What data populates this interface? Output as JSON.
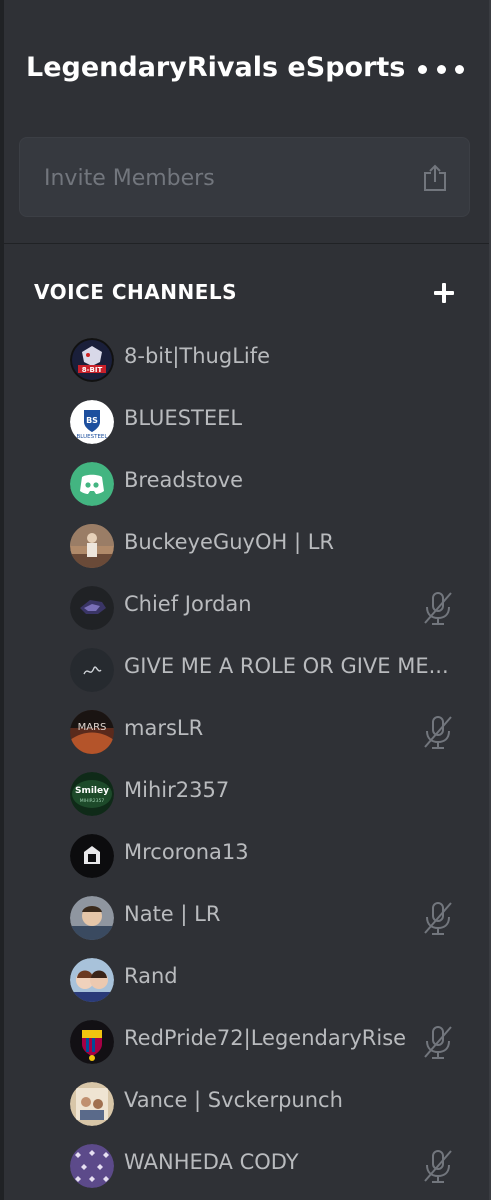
{
  "server": {
    "name": "LegendaryRivals eSports"
  },
  "invite": {
    "label": "Invite Members"
  },
  "section": {
    "title": "VOICE CHANNELS"
  },
  "members": [
    {
      "name": "8-bit|ThugLife",
      "muted": false,
      "avatar_icon": "8bit-logo-icon"
    },
    {
      "name": "BLUESTEEL",
      "muted": false,
      "avatar_icon": "bluesteel-logo-icon"
    },
    {
      "name": "Breadstove",
      "muted": false,
      "avatar_icon": "discord-default-icon"
    },
    {
      "name": "BuckeyeGuyOH | LR",
      "muted": false,
      "avatar_icon": "photo-avatar-icon"
    },
    {
      "name": "Chief Jordan",
      "muted": true,
      "avatar_icon": "panther-logo-icon"
    },
    {
      "name": "GIVE ME A ROLE OR GIVE ME...",
      "muted": false,
      "avatar_icon": "signature-avatar-icon"
    },
    {
      "name": "marsLR",
      "muted": true,
      "avatar_icon": "mars-avatar-icon"
    },
    {
      "name": "Mihir2357",
      "muted": false,
      "avatar_icon": "smiley-logo-icon"
    },
    {
      "name": "Mrcorona13",
      "muted": false,
      "avatar_icon": "dark-logo-icon"
    },
    {
      "name": "Nate | LR",
      "muted": true,
      "avatar_icon": "photo-avatar-icon"
    },
    {
      "name": "Rand",
      "muted": false,
      "avatar_icon": "photo-avatar-icon"
    },
    {
      "name": "RedPride72|LegendaryRise",
      "muted": true,
      "avatar_icon": "barcelona-logo-icon"
    },
    {
      "name": "Vance | Svckerpunch",
      "muted": false,
      "avatar_icon": "photo-avatar-icon"
    },
    {
      "name": "WANHEDA CODY",
      "muted": true,
      "avatar_icon": "pattern-avatar-icon"
    }
  ],
  "colors": {
    "background": "#2f3136",
    "invite_background": "#36393f",
    "text_muted": "#b9bbbe",
    "discord_green": "#43b581"
  }
}
